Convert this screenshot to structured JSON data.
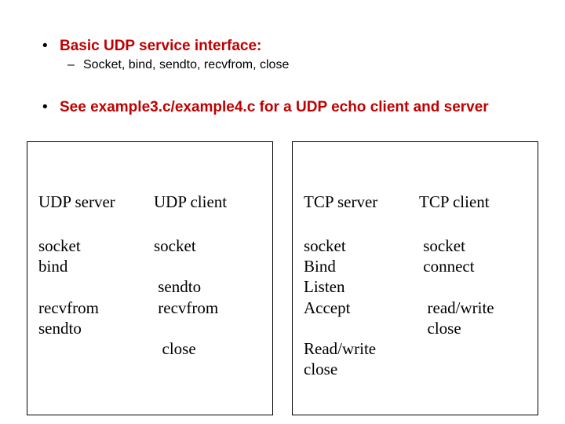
{
  "bullets": {
    "b1": "Basic UDP service interface:",
    "b1_sub": "Socket, bind, sendto, recvfrom, close",
    "b2": "See example3.c/example4.c for a UDP echo client and server"
  },
  "left_box": {
    "col1_head": "UDP server",
    "col1_body": "socket\nbind\n\nrecvfrom\nsendto",
    "col2_head": "UDP client",
    "col2_body": "socket\n\n sendto\n recvfrom\n\n  close"
  },
  "right_box": {
    "col1_head": "TCP server",
    "col1_body": "socket\nBind\nListen\nAccept\n\nRead/write\nclose",
    "col2_head": "TCP client",
    "col2_body": " socket\n connect\n\n  read/write\n  close"
  }
}
